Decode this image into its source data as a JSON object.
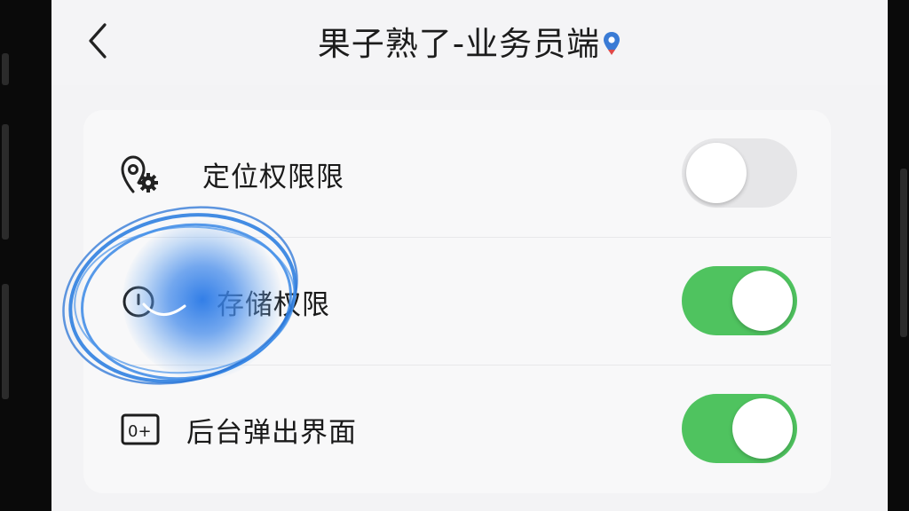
{
  "header": {
    "title": "果子熟了-业务员端",
    "back_icon": "chevron-left-icon",
    "title_badge_icon": "location-pin-icon"
  },
  "permissions": [
    {
      "label": "定位权限限",
      "icon": "location-settings-icon",
      "enabled": false
    },
    {
      "label": "存储权限",
      "icon": "storage-info-icon",
      "enabled": true
    },
    {
      "label": "后台弹出界面",
      "icon": "popup-window-icon",
      "enabled": true
    }
  ],
  "colors": {
    "toggle_on": "#4fc35f",
    "toggle_off": "#e6e6e8",
    "highlight": "#2f7fe0"
  }
}
